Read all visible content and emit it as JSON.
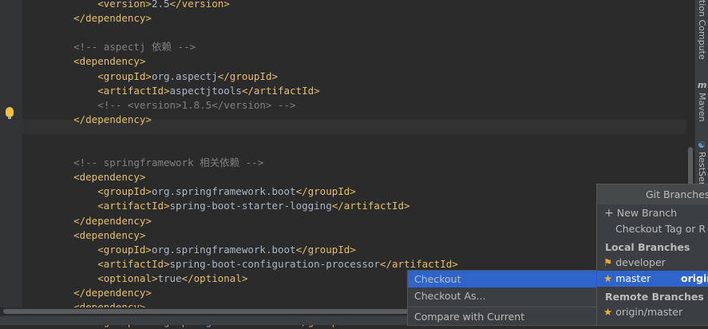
{
  "editor": {
    "lines": [
      {
        "indent": "        ",
        "parts": [
          [
            "tag",
            "<version>"
          ],
          [
            "txt",
            "2.5"
          ],
          [
            "tag",
            "</version>"
          ]
        ]
      },
      {
        "indent": "    ",
        "parts": [
          [
            "tag",
            "</dependency>"
          ]
        ]
      },
      {
        "indent": "",
        "parts": []
      },
      {
        "indent": "    ",
        "parts": [
          [
            "cmt",
            "<!-- aspectj 依赖 -->"
          ]
        ]
      },
      {
        "indent": "    ",
        "parts": [
          [
            "tag",
            "<dependency>"
          ]
        ]
      },
      {
        "indent": "        ",
        "parts": [
          [
            "tag",
            "<groupId>"
          ],
          [
            "txt",
            "org.aspectj"
          ],
          [
            "tag",
            "</groupId>"
          ]
        ]
      },
      {
        "indent": "        ",
        "parts": [
          [
            "tag",
            "<artifactId>"
          ],
          [
            "txt",
            "aspectjtools"
          ],
          [
            "tag",
            "</artifactId>"
          ]
        ]
      },
      {
        "indent": "        ",
        "parts": [
          [
            "cmt",
            "<!-- <version>1.8.5</version> -->"
          ]
        ]
      },
      {
        "indent": "    ",
        "parts": [
          [
            "tag",
            "</dependency>"
          ]
        ]
      },
      {
        "indent": "",
        "parts": []
      },
      {
        "indent": "",
        "parts": []
      },
      {
        "indent": "    ",
        "parts": [
          [
            "cmt",
            "<!-- springframework 相关依赖 -->"
          ]
        ]
      },
      {
        "indent": "    ",
        "parts": [
          [
            "tag",
            "<dependency>"
          ]
        ]
      },
      {
        "indent": "        ",
        "parts": [
          [
            "tag",
            "<groupId>"
          ],
          [
            "txt",
            "org.springframework.boot"
          ],
          [
            "tag",
            "</groupId>"
          ]
        ]
      },
      {
        "indent": "        ",
        "parts": [
          [
            "tag",
            "<artifactId>"
          ],
          [
            "txt",
            "spring-boot-starter-logging"
          ],
          [
            "tag",
            "</artifactId>"
          ]
        ]
      },
      {
        "indent": "    ",
        "parts": [
          [
            "tag",
            "</dependency>"
          ]
        ]
      },
      {
        "indent": "    ",
        "parts": [
          [
            "tag",
            "<dependency>"
          ]
        ]
      },
      {
        "indent": "        ",
        "parts": [
          [
            "tag",
            "<groupId>"
          ],
          [
            "txt",
            "org.springframework.boot"
          ],
          [
            "tag",
            "</groupId>"
          ]
        ]
      },
      {
        "indent": "        ",
        "parts": [
          [
            "tag",
            "<artifactId>"
          ],
          [
            "txt",
            "spring-boot-configuration-processor"
          ],
          [
            "tag",
            "</artifactId>"
          ]
        ]
      },
      {
        "indent": "        ",
        "parts": [
          [
            "tag",
            "<optional>"
          ],
          [
            "txt",
            "true"
          ],
          [
            "tag",
            "</optional>"
          ]
        ]
      },
      {
        "indent": "    ",
        "parts": [
          [
            "tag",
            "</dependency>"
          ]
        ]
      },
      {
        "indent": "    ",
        "parts": [
          [
            "tag",
            "<dependency>"
          ]
        ]
      },
      {
        "indent": "        ",
        "parts": [
          [
            "tag",
            "<groupId>"
          ],
          [
            "txt",
            "org.springframework.boot"
          ],
          [
            "tag",
            "</groupId>"
          ]
        ]
      }
    ]
  },
  "right_toolbar": {
    "tab1": "tion Compute",
    "tab2": "Maven",
    "tab2_icon": "m",
    "tab3": "RestSer"
  },
  "git_popup": {
    "title": "Git Branches",
    "new_branch": "New Branch",
    "checkout_tag": "Checkout Tag or R",
    "local_header": "Local Branches",
    "local": [
      {
        "icon": "tag-icon",
        "name": "developer",
        "tracking": ""
      },
      {
        "icon": "star-icon",
        "name": "master",
        "tracking": "origin"
      }
    ],
    "remote_header": "Remote Branches",
    "remote": [
      {
        "icon": "star-icon",
        "name": "origin/master"
      }
    ]
  },
  "branch_submenu": {
    "items": [
      "Checkout",
      "Checkout As...",
      "Compare with Current"
    ]
  },
  "colors": {
    "selection": "#2f65ca",
    "tag": "#e8bf6a",
    "comment": "#808080",
    "text": "#a9b7c6"
  }
}
